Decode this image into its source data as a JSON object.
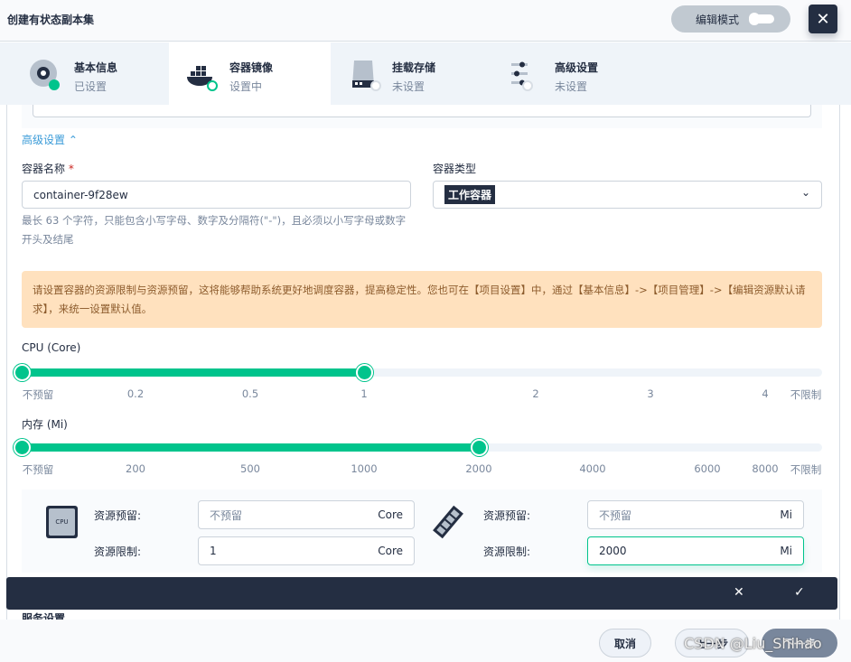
{
  "header": {
    "title": "创建有状态副本集",
    "edit_mode_label": "编辑模式",
    "close_icon": "✕"
  },
  "tabs": [
    {
      "title": "基本信息",
      "status": "已设置",
      "icon": "disc-icon",
      "state": "done"
    },
    {
      "title": "容器镜像",
      "status": "设置中",
      "icon": "docker-icon",
      "state": "active"
    },
    {
      "title": "挂载存储",
      "status": "未设置",
      "icon": "storage-icon",
      "state": "todo"
    },
    {
      "title": "高级设置",
      "status": "未设置",
      "icon": "sliders-icon",
      "state": "todo"
    }
  ],
  "form": {
    "advanced_toggle": "高级设置 ⌃",
    "name_label": "容器名称",
    "required_mark": "*",
    "name_value": "container-9f28ew",
    "name_hint": "最长 63 个字符，只能包含小写字母、数字及分隔符(\"-\")，且必须以小写字母或数字开头及结尾",
    "type_label": "容器类型",
    "type_value": "工作容器",
    "chevron": "⌄"
  },
  "alert": "请设置容器的资源限制与资源预留，这将能够帮助系统更好地调度容器，提高稳定性。您也可在【项目设置】中，通过【基本信息】->【项目管理】->【编辑资源默认请求】，来统一设置默认值。",
  "cpu_slider": {
    "label": "CPU (Core)",
    "ticks": [
      "不预留",
      "0.2",
      "0.5",
      "1",
      "2",
      "3",
      "4",
      "不限制"
    ],
    "reserve": "不预留",
    "limit": "1"
  },
  "memory_slider": {
    "label": "内存 (Mi)",
    "ticks": [
      "不预留",
      "200",
      "500",
      "1000",
      "2000",
      "4000",
      "6000",
      "8000",
      "不限制"
    ],
    "reserve": "不预留",
    "limit": "2000"
  },
  "resources": {
    "cpu_icon_text": "CPU",
    "reserve_label": "资源预留:",
    "limit_label": "资源限制:",
    "cpu_reserve_placeholder": "不预留",
    "cpu_limit_value": "1",
    "cpu_unit": "Core",
    "mem_reserve_placeholder": "不预留",
    "mem_limit_value": "2000",
    "mem_unit": "Mi"
  },
  "darkbar": {
    "cancel": "✕",
    "confirm": "✓"
  },
  "next_section": "服务设置",
  "footer": {
    "cancel": "取消",
    "prev": "上一步",
    "next": "下一步"
  },
  "watermark": "CSDN @Liu_Shihao",
  "colors": {
    "accent": "#00c48c",
    "dark": "#242e42",
    "alert_bg": "#ffe1be"
  }
}
